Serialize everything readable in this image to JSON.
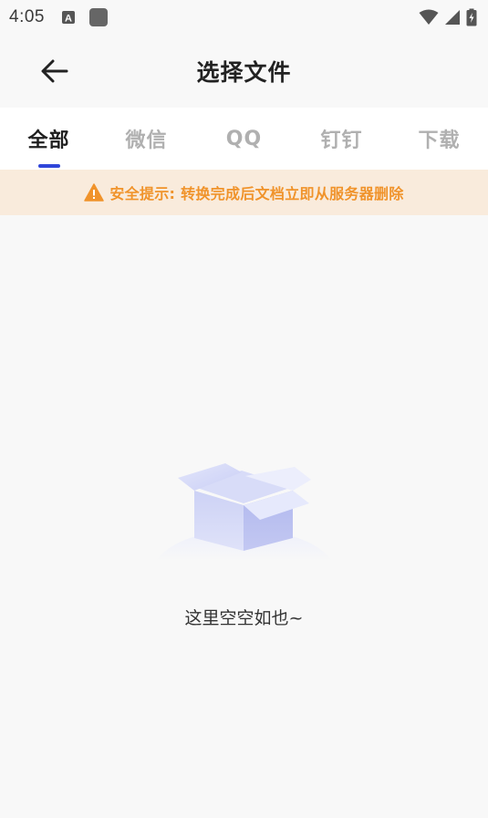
{
  "status_bar": {
    "time": "4:05",
    "notification_letter": "A"
  },
  "header": {
    "title": "选择文件"
  },
  "tabs": [
    {
      "label": "全部",
      "active": true
    },
    {
      "label": "微信",
      "active": false
    },
    {
      "label": "QQ",
      "active": false
    },
    {
      "label": "钉钉",
      "active": false
    },
    {
      "label": "下载",
      "active": false
    }
  ],
  "notice": {
    "text": "安全提示: 转换完成后文档立即从服务器删除",
    "color": "#f0932b"
  },
  "empty_state": {
    "text": "这里空空如也~"
  },
  "colors": {
    "accent": "#3046d9",
    "notice_bg": "#f9ebdc"
  }
}
